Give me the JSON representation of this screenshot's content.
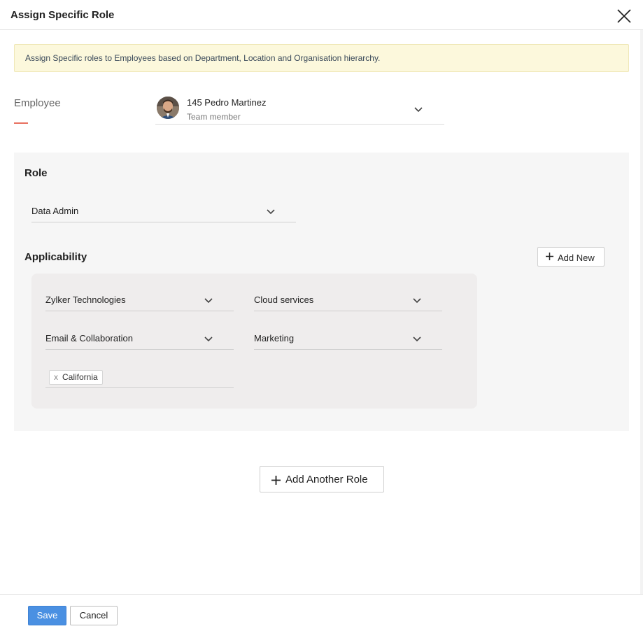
{
  "dialog": {
    "title": "Assign Specific Role",
    "close_icon": "close-icon",
    "accent_color": "#4a90e2"
  },
  "info_banner": {
    "text": "Assign Specific roles to Employees based on Department, Location and Organisation hierarchy.",
    "bg_color": "#fcf8dc"
  },
  "employee": {
    "label": "Employee",
    "name": "145 Pedro Martinez",
    "subtitle": "Team member",
    "avatar_icon": "avatar"
  },
  "role_section": {
    "title": "Role",
    "selected_role": "Data Admin"
  },
  "applicability": {
    "title": "Applicability",
    "add_new_label": "Add New",
    "organization": "Zylker Technologies",
    "business_unit": "Cloud services",
    "department": "Email & Collaboration",
    "division": "Marketing",
    "location_tags": [
      "California"
    ]
  },
  "add_another_role_label": "Add Another Role",
  "footer": {
    "save_label": "Save",
    "cancel_label": "Cancel",
    "save_color": "#4a90e2"
  }
}
